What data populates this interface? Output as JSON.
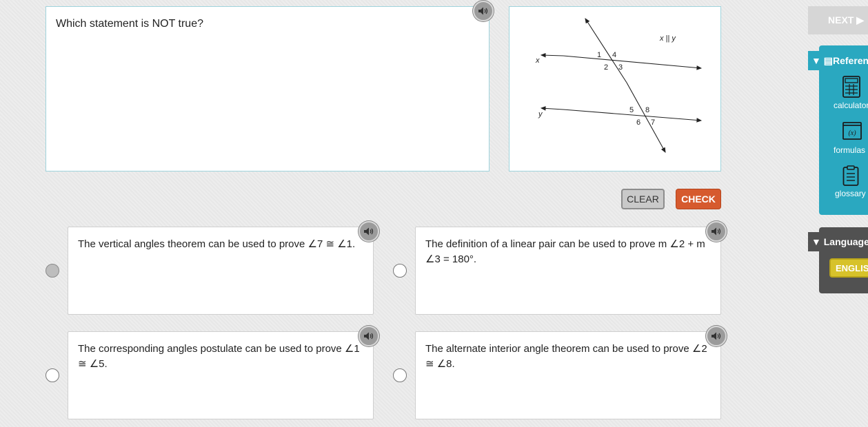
{
  "question": {
    "text": "Which statement is NOT true?"
  },
  "figure": {
    "parallel_note": "x || y",
    "line_x_label": "x",
    "line_y_label": "y",
    "angle_labels": [
      "1",
      "4",
      "2",
      "3",
      "5",
      "8",
      "6",
      "7"
    ]
  },
  "buttons": {
    "clear": "CLEAR",
    "check": "CHECK",
    "next": "NEXT ▶"
  },
  "answers": [
    {
      "text": "The vertical angles theorem can be used to prove ∠7 ≅ ∠1.",
      "selected": true
    },
    {
      "text": "The definition of a linear pair can be used to prove m ∠2 + m ∠3 = 180°.",
      "selected": false
    },
    {
      "text": "The corresponding angles postulate can be used to prove ∠1 ≅ ∠5.",
      "selected": false
    },
    {
      "text": "The alternate interior angle theorem can be used to prove ∠2 ≅ ∠8.",
      "selected": false
    }
  ],
  "sidebar": {
    "reference_header": "▼ ▤Reference",
    "tools": [
      {
        "label": "calculator",
        "icon": "calculator-icon"
      },
      {
        "label": "formulas",
        "icon": "formulas-icon",
        "glyph": "(x)"
      },
      {
        "label": "glossary",
        "icon": "glossary-icon"
      }
    ],
    "language_header": "▼ Language",
    "language_button": "ENGLISH"
  },
  "colors": {
    "accent_teal": "#2aa8c0",
    "check_orange": "#d65a2e",
    "english_yellow": "#d7c22a",
    "language_gray": "#515151"
  }
}
